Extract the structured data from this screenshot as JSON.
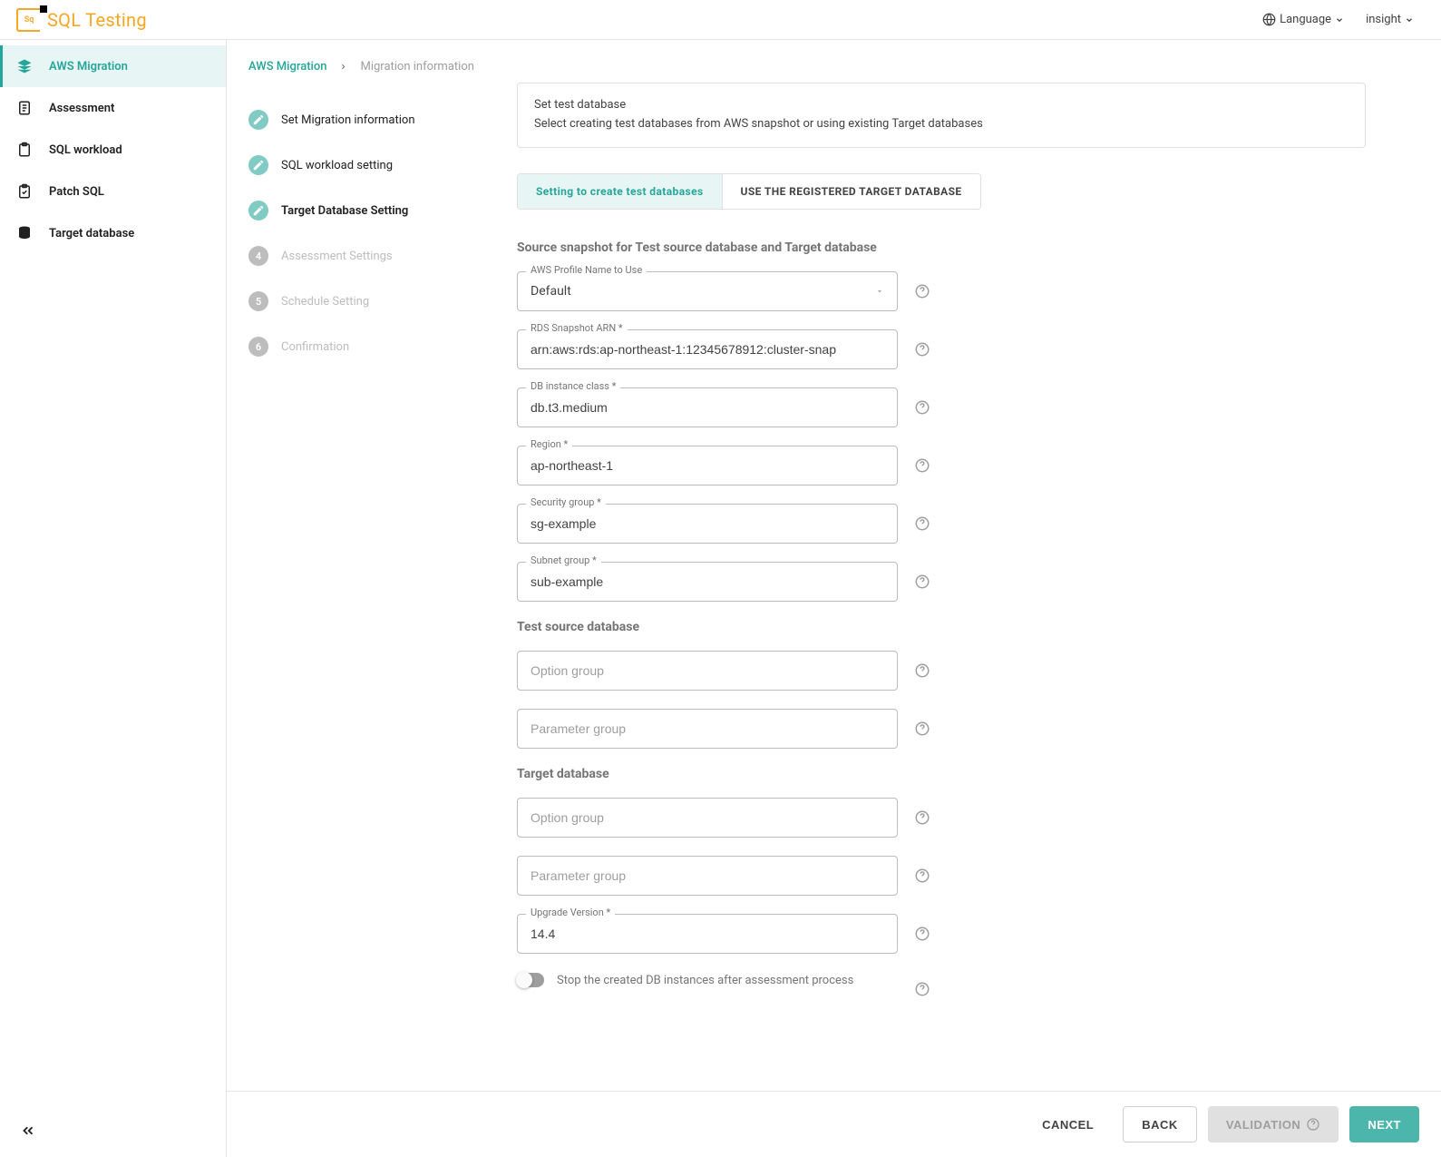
{
  "brand": "SQL Testing",
  "topbar": {
    "language": "Language",
    "user": "insight"
  },
  "sidebar": {
    "items": [
      {
        "label": "AWS Migration",
        "active": true
      },
      {
        "label": "Assessment"
      },
      {
        "label": "SQL workload"
      },
      {
        "label": "Patch SQL"
      },
      {
        "label": "Target database"
      }
    ]
  },
  "breadcrumb": {
    "link": "AWS Migration",
    "current": "Migration information"
  },
  "steps": [
    {
      "label": "Set Migration information",
      "state": "done"
    },
    {
      "label": "SQL workload setting",
      "state": "done"
    },
    {
      "label": "Target Database Setting",
      "state": "current"
    },
    {
      "label": "Assessment Settings",
      "state": "pending",
      "num": "4"
    },
    {
      "label": "Schedule Setting",
      "state": "pending",
      "num": "5"
    },
    {
      "label": "Confirmation",
      "state": "pending",
      "num": "6"
    }
  ],
  "info": {
    "title": "Set test database",
    "desc": "Select creating test databases from AWS snapshot or using existing Target databases"
  },
  "tabs": {
    "a": "Setting to create test databases",
    "b": "USE THE REGISTERED TARGET DATABASE"
  },
  "form": {
    "section1_title": "Source snapshot for Test source database and Target database",
    "aws_profile": {
      "label": "AWS Profile Name to Use",
      "value": "Default"
    },
    "rds_arn": {
      "label": "RDS Snapshot ARN *",
      "value": "arn:aws:rds:ap-northeast-1:12345678912:cluster-snap"
    },
    "instance_class": {
      "label": "DB instance class *",
      "value": "db.t3.medium"
    },
    "region": {
      "label": "Region *",
      "value": "ap-northeast-1"
    },
    "security_group": {
      "label": "Security group *",
      "value": "sg-example"
    },
    "subnet_group": {
      "label": "Subnet group *",
      "value": "sub-example"
    },
    "section2_title": "Test source database",
    "src_option_group": {
      "placeholder": "Option group"
    },
    "src_param_group": {
      "placeholder": "Parameter group"
    },
    "section3_title": "Target database",
    "tgt_option_group": {
      "placeholder": "Option group"
    },
    "tgt_param_group": {
      "placeholder": "Parameter group"
    },
    "upgrade_version": {
      "label": "Upgrade Version *",
      "value": "14.4"
    },
    "toggle_label": "Stop the created DB instances after assessment process"
  },
  "footer": {
    "cancel": "CANCEL",
    "back": "BACK",
    "validation": "VALIDATION",
    "next": "NEXT"
  }
}
